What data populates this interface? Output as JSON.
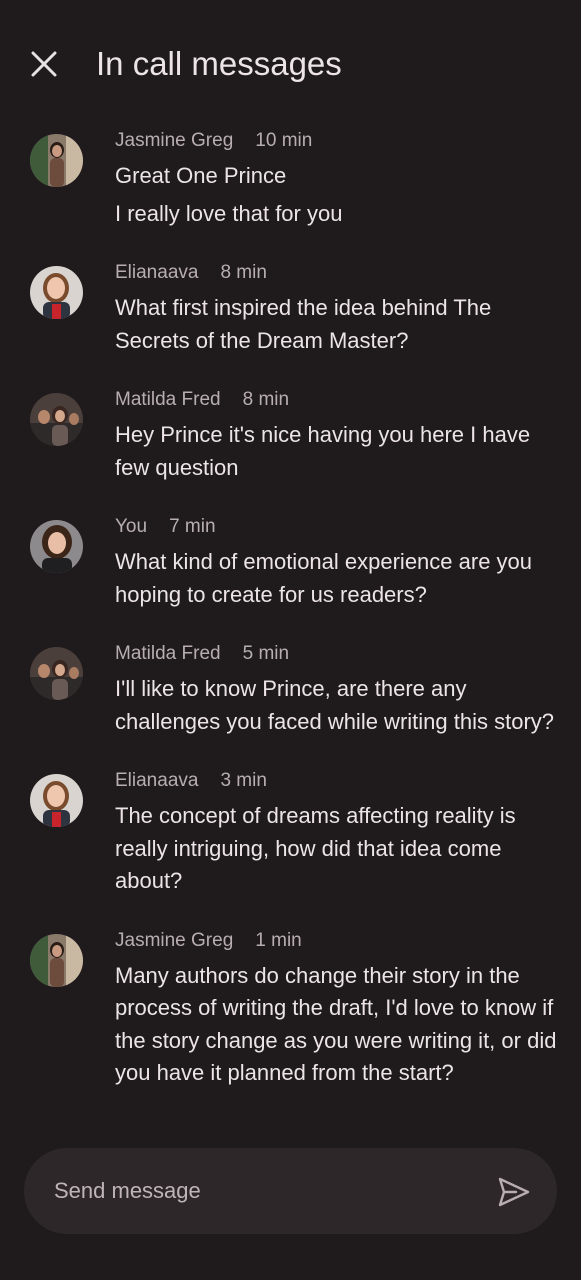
{
  "header": {
    "title": "In call messages",
    "close_icon": "close-icon"
  },
  "messages": [
    {
      "author": "Jasmine Greg",
      "time": "10 min",
      "lines": [
        "Great One Prince",
        "I really love that for you"
      ]
    },
    {
      "author": "Elianaava",
      "time": "8 min",
      "lines": [
        "What first inspired the idea behind The Secrets of the Dream Master?"
      ]
    },
    {
      "author": "Matilda Fred",
      "time": "8 min",
      "lines": [
        "Hey Prince it's nice having you here I have few question"
      ]
    },
    {
      "author": "You",
      "time": "7 min",
      "lines": [
        "What kind of emotional experience are you hoping to create for us  readers?"
      ]
    },
    {
      "author": "Matilda Fred",
      "time": "5 min",
      "lines": [
        "I'll like to know Prince, are there any challenges you faced while writing this story?"
      ]
    },
    {
      "author": "Elianaava",
      "time": "3 min",
      "lines": [
        "The concept of dreams affecting reality is really intriguing, how did that idea come about?"
      ]
    },
    {
      "author": "Jasmine Greg",
      "time": "1 min",
      "lines": [
        "Many authors do change their story in the process of writing the draft, I'd love to know if the story change as you were writing it, or did you have it planned from the start?"
      ]
    }
  ],
  "composer": {
    "placeholder": "Send message",
    "value": "",
    "send_icon": "send-icon"
  },
  "colors": {
    "background": "#1f1a1c",
    "composer": "#2e2729",
    "primary_text": "#ece4e6",
    "secondary_text": "#b8aeb2"
  }
}
